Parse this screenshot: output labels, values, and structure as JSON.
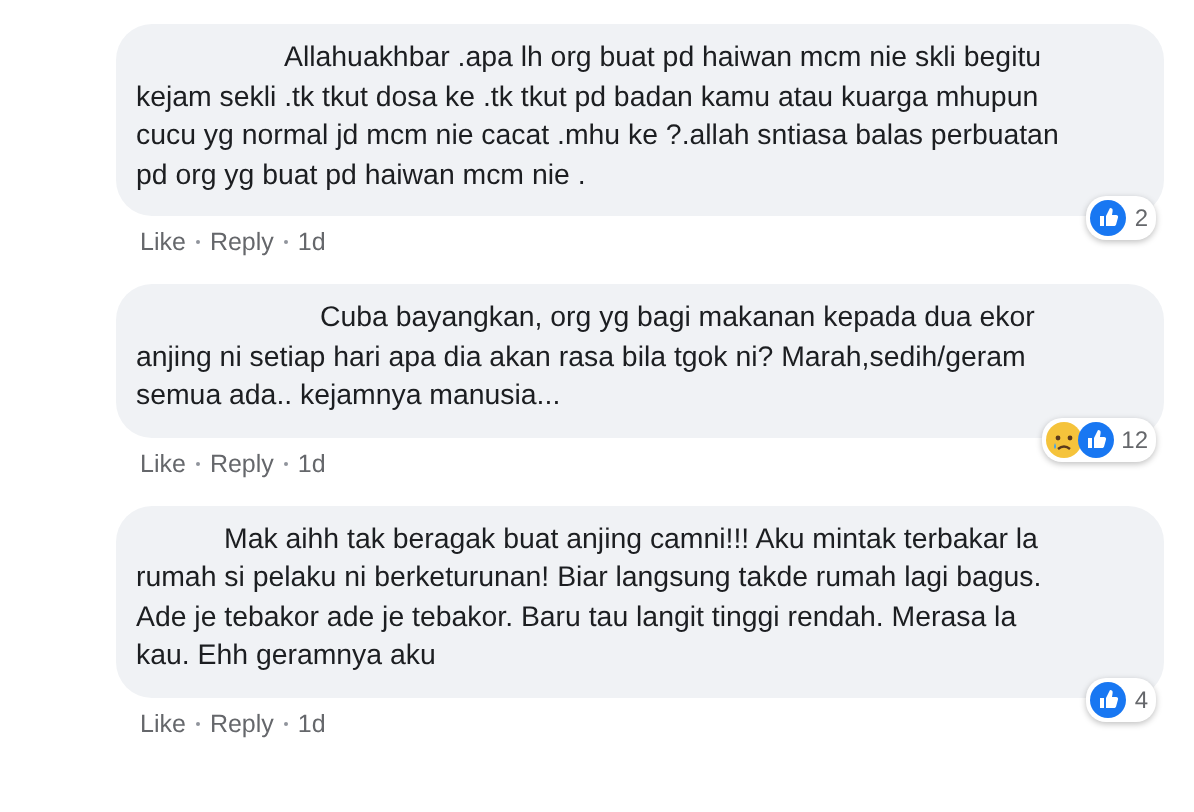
{
  "comments": [
    {
      "text": "Allahuakhbar .apa lh org buat pd haiwan mcm nie skli begitu kejam sekli .tk tkut dosa ke .tk tkut pd badan kamu atau kuarga mhupun cucu yg normal jd mcm nie cacat .mhu ke ?.allah sntiasa balas perbuatan pd org yg buat pd haiwan mcm nie .",
      "reactions": [
        {
          "kind": "like"
        }
      ],
      "reaction_count": "2",
      "actions": [
        "Like",
        "Reply"
      ],
      "time": "1d"
    },
    {
      "text": "Cuba bayangkan, org yg bagi makanan kepada dua ekor anjing ni setiap hari apa dia akan rasa bila tgok ni? Marah,sedih/geram semua ada.. kejamnya manusia...",
      "reactions": [
        {
          "kind": "sad"
        },
        {
          "kind": "like"
        }
      ],
      "reaction_count": "12",
      "actions": [
        "Like",
        "Reply"
      ],
      "time": "1d"
    },
    {
      "text": "Mak aihh tak beragak buat anjing camni!!! Aku mintak terbakar la rumah si pelaku ni berketurunan! Biar langsung takde rumah lagi bagus. Ade je tebakor ade je tebakor. Baru tau langit tinggi rendah. Merasa la kau. Ehh geramnya aku",
      "reactions": [
        {
          "kind": "like"
        }
      ],
      "reaction_count": "4",
      "actions": [
        "Like",
        "Reply"
      ],
      "time": "1d"
    }
  ]
}
